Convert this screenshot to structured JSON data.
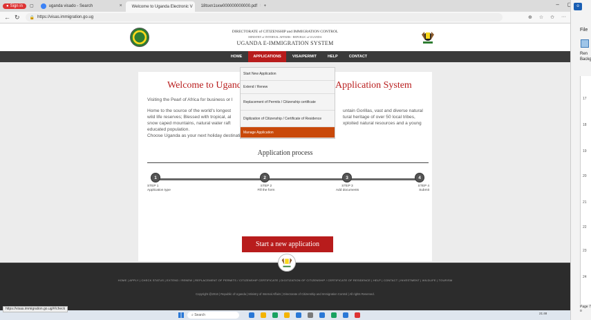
{
  "browser": {
    "signin_label": "Sign in",
    "tabs": [
      {
        "label": "uganda visado - Search"
      },
      {
        "label": "Welcome to Uganda Electronic V"
      },
      {
        "label": "18tsxn1sxw000000000000.pdf"
      }
    ],
    "new_tab": "+",
    "url": "https://visas.immigration.go.ug",
    "status_url": "https://visas.immigration.go.ug/#/check"
  },
  "sidepanel": {
    "file_label": "File",
    "remove_label_1": "Ren",
    "remove_label_2": "Backg",
    "ruler_marks": [
      "17",
      "18",
      "19",
      "20",
      "21",
      "22",
      "23",
      "24"
    ],
    "page_label": "Page 7 o"
  },
  "header": {
    "line1": "DIRECTORATE of CITIZENSHIP and IMMIGRATION CONTROL",
    "line2": "MINISTRY of INTERNAL AFFAIRS - REPUBLIC of UGANDA",
    "line3": "UGANDA E-IMMIGRATION SYSTEM"
  },
  "nav": {
    "items": [
      "HOME",
      "APPLICATIONS",
      "VISA/PERMIT",
      "HELP",
      "CONTACT"
    ]
  },
  "dropdown": {
    "items": [
      "Start New Application",
      "Extend / Renew",
      "Replacement of Permits / Citizenship certificate",
      "Digitization of Citizenship / Certificate of Residence",
      "Manage Application"
    ]
  },
  "main": {
    "welcome_start": "Welcome to Uganda",
    "welcome_end": "Application System",
    "p1": "Visiting the Pearl of Africa for business or l",
    "p2_a": "Home to the source of the world's longest",
    "p2_b": "untain Gorillas, vast and diverse natural",
    "p2_c": "wild life reserves; Blessed with tropical, al",
    "p2_d": "tural heritage of over 50 local tribes,",
    "p2_e": "snow caped mountains, natural water raft",
    "p2_f": "xploited natural resources and a young",
    "p2_g": "educated population.",
    "p3": "Choose Uganda as your next holiday destination and experience true African hospitality.",
    "process_title": "Application process",
    "steps": [
      {
        "num": "1",
        "label": "STEP 1",
        "desc": "Application type"
      },
      {
        "num": "2",
        "label": "STEP 2",
        "desc": "Fill the form"
      },
      {
        "num": "3",
        "label": "STEP 3",
        "desc": "Add documents"
      },
      {
        "num": "4",
        "label": "STEP 4",
        "desc": "Submit"
      }
    ],
    "start_button": "Start a new application"
  },
  "footer": {
    "links": "HOME  |  APPLY  |  CHECK STATUS  |  EXTEND / RENEW  |  REPLACEMENT OF PERMITS / CITIZENSHIP CERTIFICATE  |  DIGITIZATION OF CITIZENSHIP / CERTIFICATE OF RESIDENCE  |  HELP  |  CONTACT  |  INVESTMENT  |  WILDLIFE  |  TOURISM",
    "copyright": "Copyright @2016 | Republic of Uganda | Ministry of Internal Affairs | Directorate of Citizenship and Immigration Control | All rights Reserved."
  },
  "taskbar": {
    "search_placeholder": "Search",
    "clock": "21:48"
  }
}
